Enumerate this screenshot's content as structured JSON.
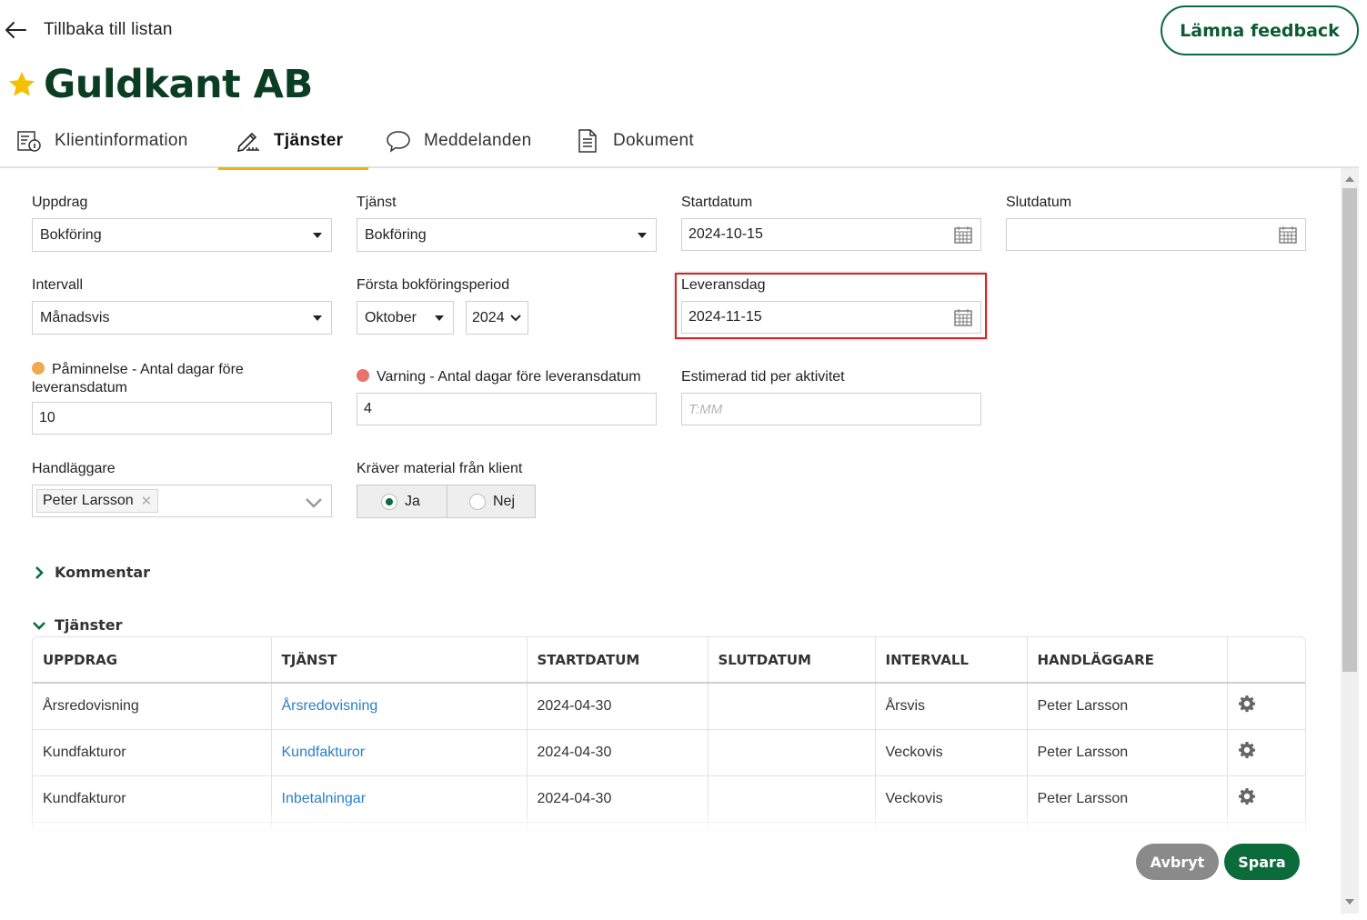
{
  "header": {
    "back_label": "Tillbaka till listan",
    "feedback_label": "Lämna feedback",
    "title": "Guldkant AB"
  },
  "tabs": [
    {
      "label": "Klientinformation",
      "icon": "client-info-icon"
    },
    {
      "label": "Tjänster",
      "icon": "pencil-ruler-icon",
      "active": true
    },
    {
      "label": "Meddelanden",
      "icon": "chat-bubble-icon"
    },
    {
      "label": "Dokument",
      "icon": "document-icon"
    }
  ],
  "form": {
    "uppdrag": {
      "label": "Uppdrag",
      "value": "Bokföring"
    },
    "tjanst": {
      "label": "Tjänst",
      "value": "Bokföring"
    },
    "startdatum": {
      "label": "Startdatum",
      "value": "2024-10-15"
    },
    "slutdatum": {
      "label": "Slutdatum",
      "value": ""
    },
    "intervall": {
      "label": "Intervall",
      "value": "Månadsvis"
    },
    "forsta_period": {
      "label": "Första bokföringsperiod",
      "month": "Oktober",
      "year": "2024"
    },
    "leveransdag": {
      "label": "Leveransdag",
      "value": "2024-11-15"
    },
    "paminnelse": {
      "label": "Påminnelse - Antal dagar före leveransdatum",
      "value": "10",
      "dot_color": "#f0a94e"
    },
    "varning": {
      "label": "Varning - Antal dagar före leveransdatum",
      "value": "4",
      "dot_color": "#e8736b"
    },
    "estimerad_tid": {
      "label": "Estimerad tid per aktivitet",
      "placeholder": "T:MM"
    },
    "handlaggare": {
      "label": "Handläggare",
      "tag": "Peter Larsson"
    },
    "kraver_material": {
      "label": "Kräver material från klient",
      "options": [
        "Ja",
        "Nej"
      ],
      "selected": "Ja"
    }
  },
  "sections": {
    "kommentar": "Kommentar",
    "tjanster": "Tjänster"
  },
  "table": {
    "columns": [
      "UPPDRAG",
      "TJÄNST",
      "STARTDATUM",
      "SLUTDATUM",
      "INTERVALL",
      "HANDLÄGGARE",
      ""
    ],
    "rows": [
      {
        "uppdrag": "Årsredovisning",
        "tjanst": "Årsredovisning",
        "start": "2024-04-30",
        "slut": "",
        "intervall": "Årsvis",
        "handlaggare": "Peter Larsson"
      },
      {
        "uppdrag": "Kundfakturor",
        "tjanst": "Kundfakturor",
        "start": "2024-04-30",
        "slut": "",
        "intervall": "Veckovis",
        "handlaggare": "Peter Larsson"
      },
      {
        "uppdrag": "Kundfakturor",
        "tjanst": "Inbetalningar",
        "start": "2024-04-30",
        "slut": "",
        "intervall": "Veckovis",
        "handlaggare": "Peter Larsson"
      }
    ]
  },
  "footer": {
    "cancel_label": "Avbryt",
    "save_label": "Spara"
  },
  "colors": {
    "brand_green": "#0b6b3a",
    "title_green": "#0b3d22",
    "tab_accent": "#f0b400",
    "link_blue": "#2a7fc9",
    "highlight_red": "#d9232a",
    "star": "#f5c000"
  }
}
